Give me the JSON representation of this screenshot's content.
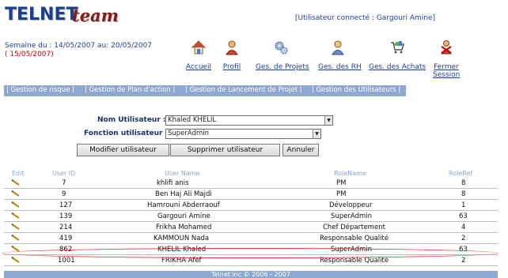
{
  "header": {
    "logo_part1": "TELNET",
    "logo_part2": "team",
    "user_connected": "[Utilisateur connecté : Gargouri Amine]",
    "week_range": "Semaine du : 14/05/2007 au: 20/05/2007",
    "current_date": "( 15/05/2007)"
  },
  "nav": [
    {
      "label": "Accueil",
      "icon": "home-icon"
    },
    {
      "label": "Profil",
      "icon": "user-profile-icon"
    },
    {
      "label": "Ges. de Projets",
      "icon": "gears-icon"
    },
    {
      "label": "Ges. des RH",
      "icon": "person-icon"
    },
    {
      "label": "Ges. des Achats",
      "icon": "cart-icon"
    },
    {
      "label": "Fermer Session",
      "icon": "logout-icon"
    }
  ],
  "tabs": [
    "| Gestion de risque |",
    "| Gestion de Plan d'action |",
    "| Gestion de Lancement de Projet |",
    "| Gestion des Utilisateurs |"
  ],
  "form": {
    "user_label": "Nom Utilisateur :",
    "user_value": "Khaled KHELIL",
    "function_label": "Fonction utilisateur :",
    "function_value": "SuperAdmin",
    "modify_button": "Modifier utilisateur",
    "delete_button": "Supprimer utilisateur",
    "cancel_button": "Annuler"
  },
  "table": {
    "headers": [
      "Edit",
      "User ID",
      "User Name",
      "RoleName",
      "RoleRef"
    ],
    "rows": [
      [
        "7",
        "khlifi anis",
        "PM",
        "8"
      ],
      [
        "9",
        "Ben Haj Ali Majdi",
        "PM",
        "8"
      ],
      [
        "127",
        "Hamrouni Abderraouf",
        "Développeur",
        "1"
      ],
      [
        "139",
        "Gargouri Amine",
        "SuperAdmin",
        "63"
      ],
      [
        "214",
        "Frikha Mohamed",
        "Chef Département",
        "4"
      ],
      [
        "419",
        "KAMMOUN Nada",
        "Responsable Qualité",
        "2"
      ],
      [
        "862",
        "KHELIL Khaled",
        "SuperAdmin",
        "63"
      ],
      [
        "1001",
        "FRIKHA Afef",
        "Responsable Qualité",
        "2"
      ]
    ]
  },
  "footer": "Telnet inc © 2006 - 2007"
}
